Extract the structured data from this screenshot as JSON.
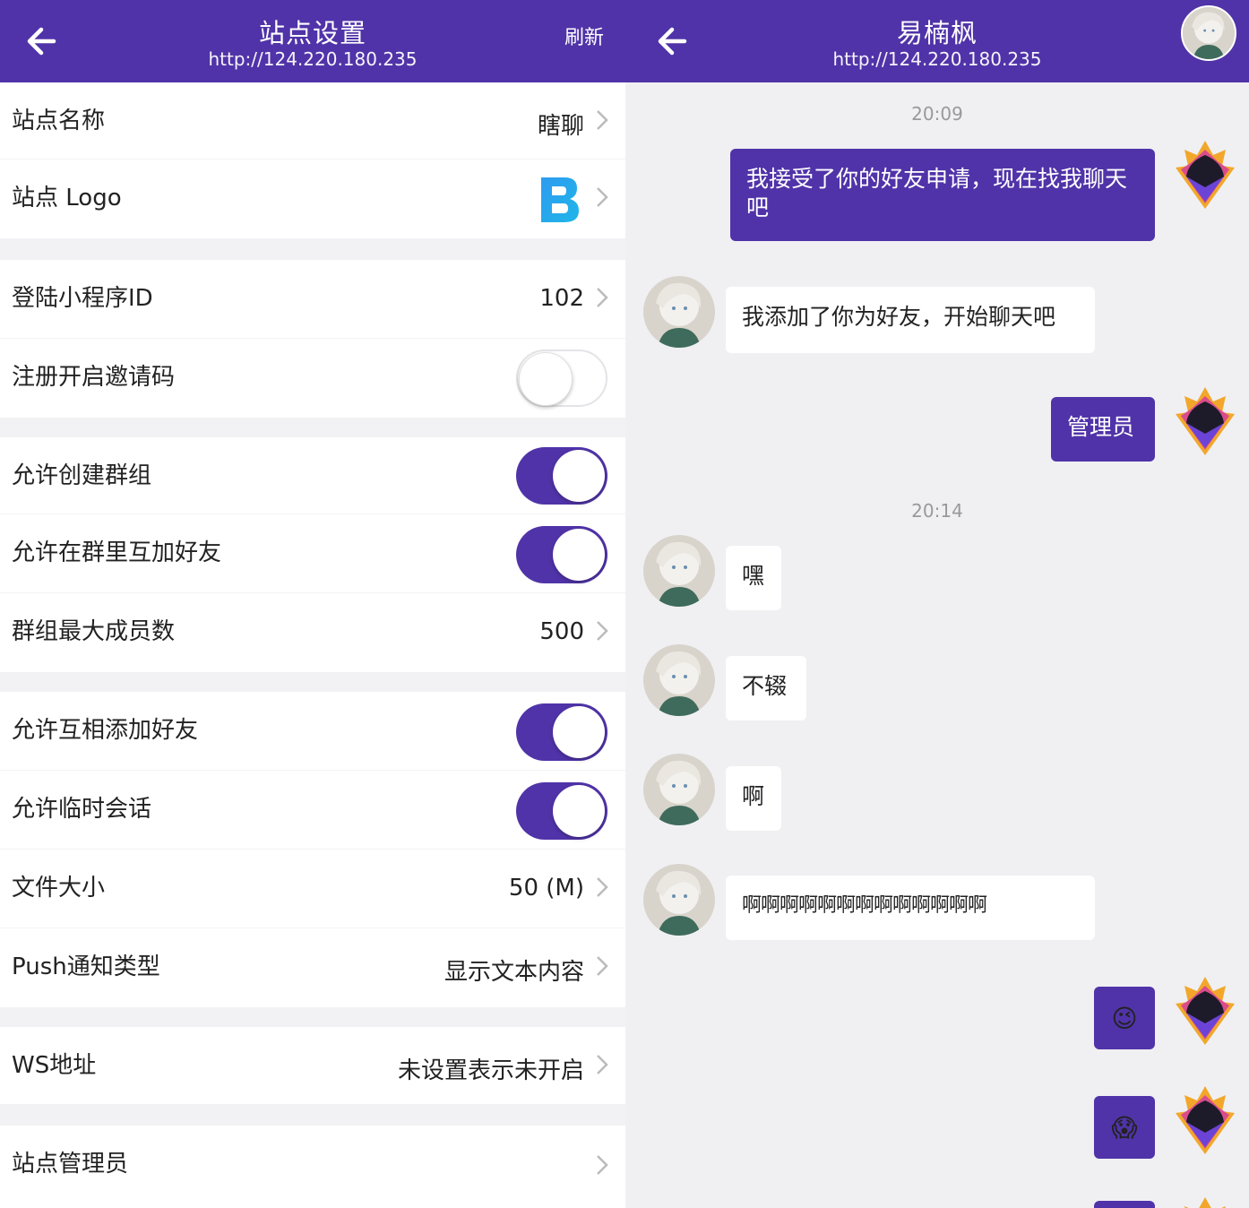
{
  "settings": {
    "title": "站点设置",
    "url": "http://124.220.180.235",
    "refresh_label": "刷新",
    "rows": [
      {
        "label": "站点名称",
        "value": "瞎聊"
      },
      {
        "label": "站点 Logo"
      },
      {
        "label": "登陆小程序ID",
        "value": "102"
      },
      {
        "label": "注册开启邀请码",
        "toggle": false
      },
      {
        "label": "允许创建群组",
        "toggle": true
      },
      {
        "label": "允许在群里互加好友",
        "toggle": true
      },
      {
        "label": "群组最大成员数",
        "value": "500"
      },
      {
        "label": "允许互相添加好友",
        "toggle": true
      },
      {
        "label": "允许临时会话",
        "toggle": true
      },
      {
        "label": "文件大小",
        "value": "50 (M)"
      },
      {
        "label": "Push通知类型",
        "value": "显示文本内容"
      },
      {
        "label": "WS地址",
        "value": "未设置表示未开启"
      },
      {
        "label": "站点管理员"
      }
    ],
    "accent_color": "#5033a8"
  },
  "chat": {
    "title": "易楠枫",
    "url": "http://124.220.180.235",
    "messages": [
      {
        "type": "time",
        "text": "20:09"
      },
      {
        "type": "out",
        "text": "我接受了你的好友申请，现在找我聊天吧"
      },
      {
        "type": "in",
        "text": "我添加了你为好友，开始聊天吧"
      },
      {
        "type": "out",
        "text": "管理员"
      },
      {
        "type": "time",
        "text": "20:14"
      },
      {
        "type": "in",
        "text": "嘿"
      },
      {
        "type": "in",
        "text": "不辍"
      },
      {
        "type": "in",
        "text": "啊"
      },
      {
        "type": "in",
        "text": "啊啊啊啊啊啊啊啊啊啊啊啊啊"
      },
      {
        "type": "out-emoji",
        "text": "😉"
      },
      {
        "type": "out-emoji",
        "text": "😱"
      }
    ]
  }
}
